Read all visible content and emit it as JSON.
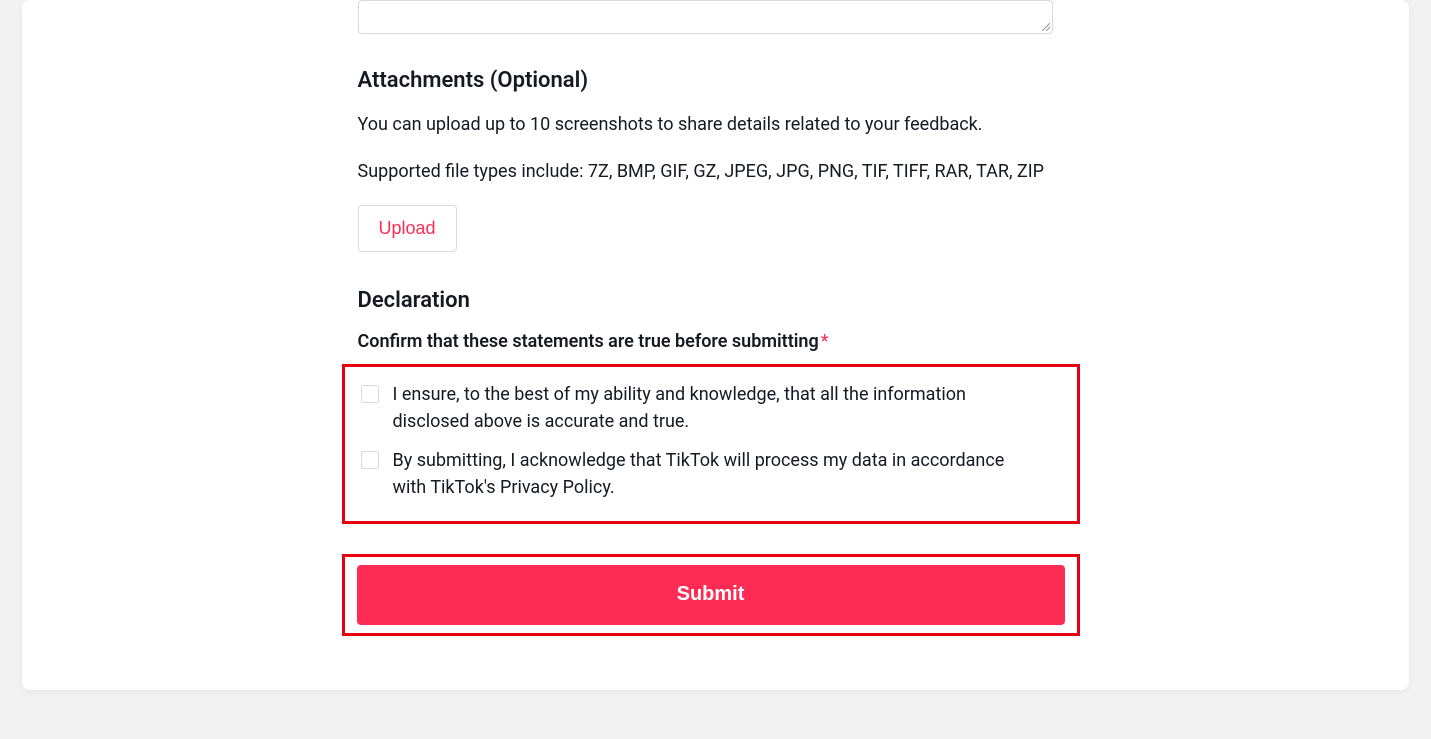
{
  "attachments": {
    "title": "Attachments (Optional)",
    "helper1": "You can upload up to 10 screenshots to share details related to your feedback.",
    "helper2": "Supported file types include: 7Z, BMP, GIF, GZ, JPEG, JPG, PNG, TIF, TIFF, RAR, TAR, ZIP",
    "upload_label": "Upload"
  },
  "declaration": {
    "title": "Declaration",
    "confirm_label": "Confirm that these statements are true before submitting",
    "required_mark": "*",
    "checkbox1_label": "I ensure, to the best of my ability and knowledge, that all the information disclosed above is accurate and true.",
    "checkbox2_label": "By submitting, I acknowledge that TikTok will process my data in accordance with TikTok's Privacy Policy."
  },
  "submit": {
    "label": "Submit"
  }
}
